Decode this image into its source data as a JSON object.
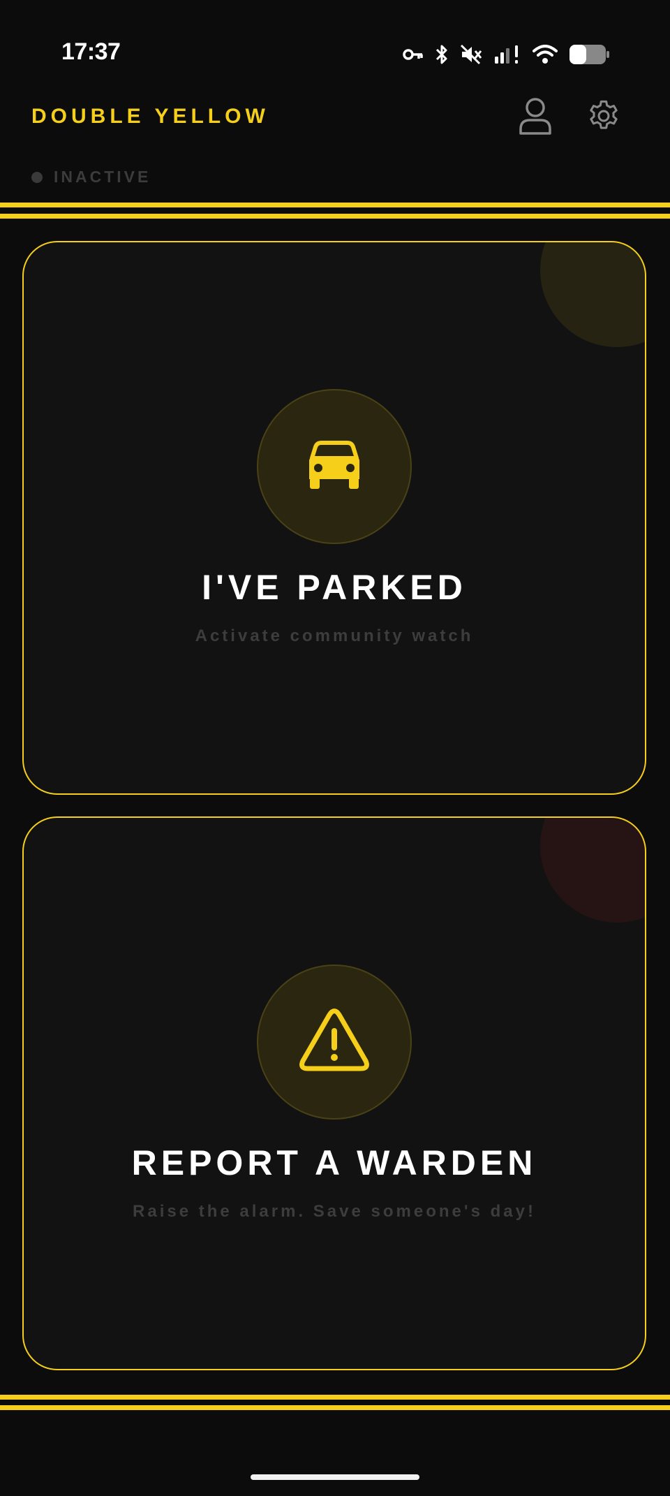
{
  "status_bar": {
    "time": "17:37",
    "icons": [
      "vpn-key-icon",
      "bluetooth-icon",
      "muted-icon",
      "signal-icon",
      "wifi-icon",
      "battery-icon"
    ]
  },
  "header": {
    "app_title": "DOUBLE YELLOW",
    "profile_icon": "person-icon",
    "settings_icon": "gear-icon"
  },
  "status": {
    "label": "INACTIVE"
  },
  "cards": [
    {
      "icon": "car-icon",
      "title": "I'VE PARKED",
      "subtitle": "Activate community watch"
    },
    {
      "icon": "warning-icon",
      "title": "REPORT A WARDEN",
      "subtitle": "Raise the alarm. Save someone's day!"
    }
  ],
  "colors": {
    "accent": "#f5cf1a",
    "background": "#0c0c0c",
    "card_background": "#121212",
    "muted_text": "#3d3d3d"
  }
}
